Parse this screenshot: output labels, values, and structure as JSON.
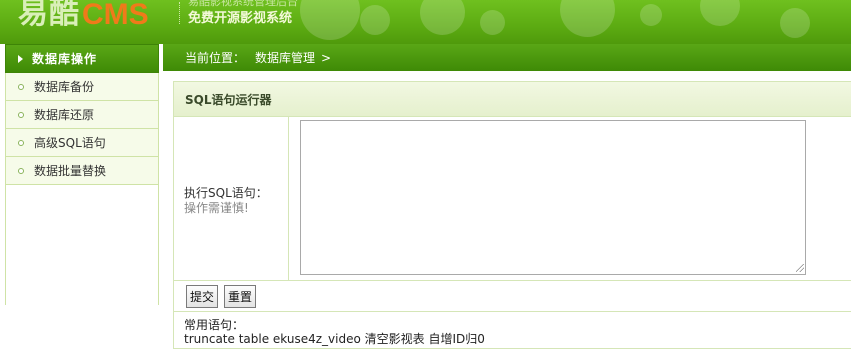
{
  "header": {
    "logo_cn": "易酷",
    "logo_en": "CMS",
    "logo_subtitle_top": "易酷影视系统管理后台",
    "logo_subtitle": "免费开源影视系统"
  },
  "sidebar": {
    "title": "数据库操作",
    "items": [
      {
        "label": "数据库备份"
      },
      {
        "label": "数据库还原"
      },
      {
        "label": "高级SQL语句"
      },
      {
        "label": "数据批量替换"
      }
    ]
  },
  "breadcrumb": {
    "prefix": "当前位置：",
    "current": "数据库管理",
    "arrow": ">"
  },
  "panel": {
    "title": "SQL语句运行器",
    "field_label": "执行SQL语句：",
    "field_note": "操作需谨慎!",
    "sql_value": "",
    "submit_label": "提交",
    "reset_label": "重置",
    "common_title": "常用语句：",
    "common_example": "truncate table ekuse4z_video 清空影视表 自增ID归0"
  },
  "colors": {
    "header_green": "#5cab12",
    "nav_green": "#4a9710",
    "logo_orange": "#f07a1a",
    "border_green": "#d5e6b7"
  }
}
